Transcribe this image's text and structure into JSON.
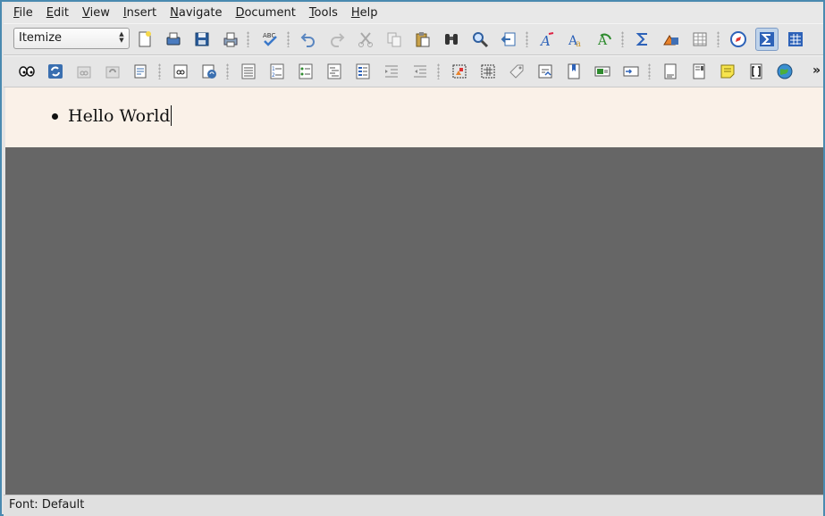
{
  "menubar": {
    "items": [
      {
        "accel": "F",
        "rest": "ile"
      },
      {
        "accel": "E",
        "rest": "dit"
      },
      {
        "accel": "V",
        "rest": "iew"
      },
      {
        "accel": "I",
        "rest": "nsert"
      },
      {
        "accel": "N",
        "rest": "avigate"
      },
      {
        "accel": "D",
        "rest": "ocument"
      },
      {
        "accel": "T",
        "rest": "ools"
      },
      {
        "accel": "H",
        "rest": "elp"
      }
    ]
  },
  "toolbar": {
    "style_value": "Itemize",
    "spell_label": "ABC",
    "overflow": "»"
  },
  "document": {
    "line": "Hello World"
  },
  "status": {
    "text": "Font: Default"
  },
  "colors": {
    "accent": "#4a8ab0",
    "doc_background": "#faf1e8",
    "canvas_gray": "#666666"
  }
}
